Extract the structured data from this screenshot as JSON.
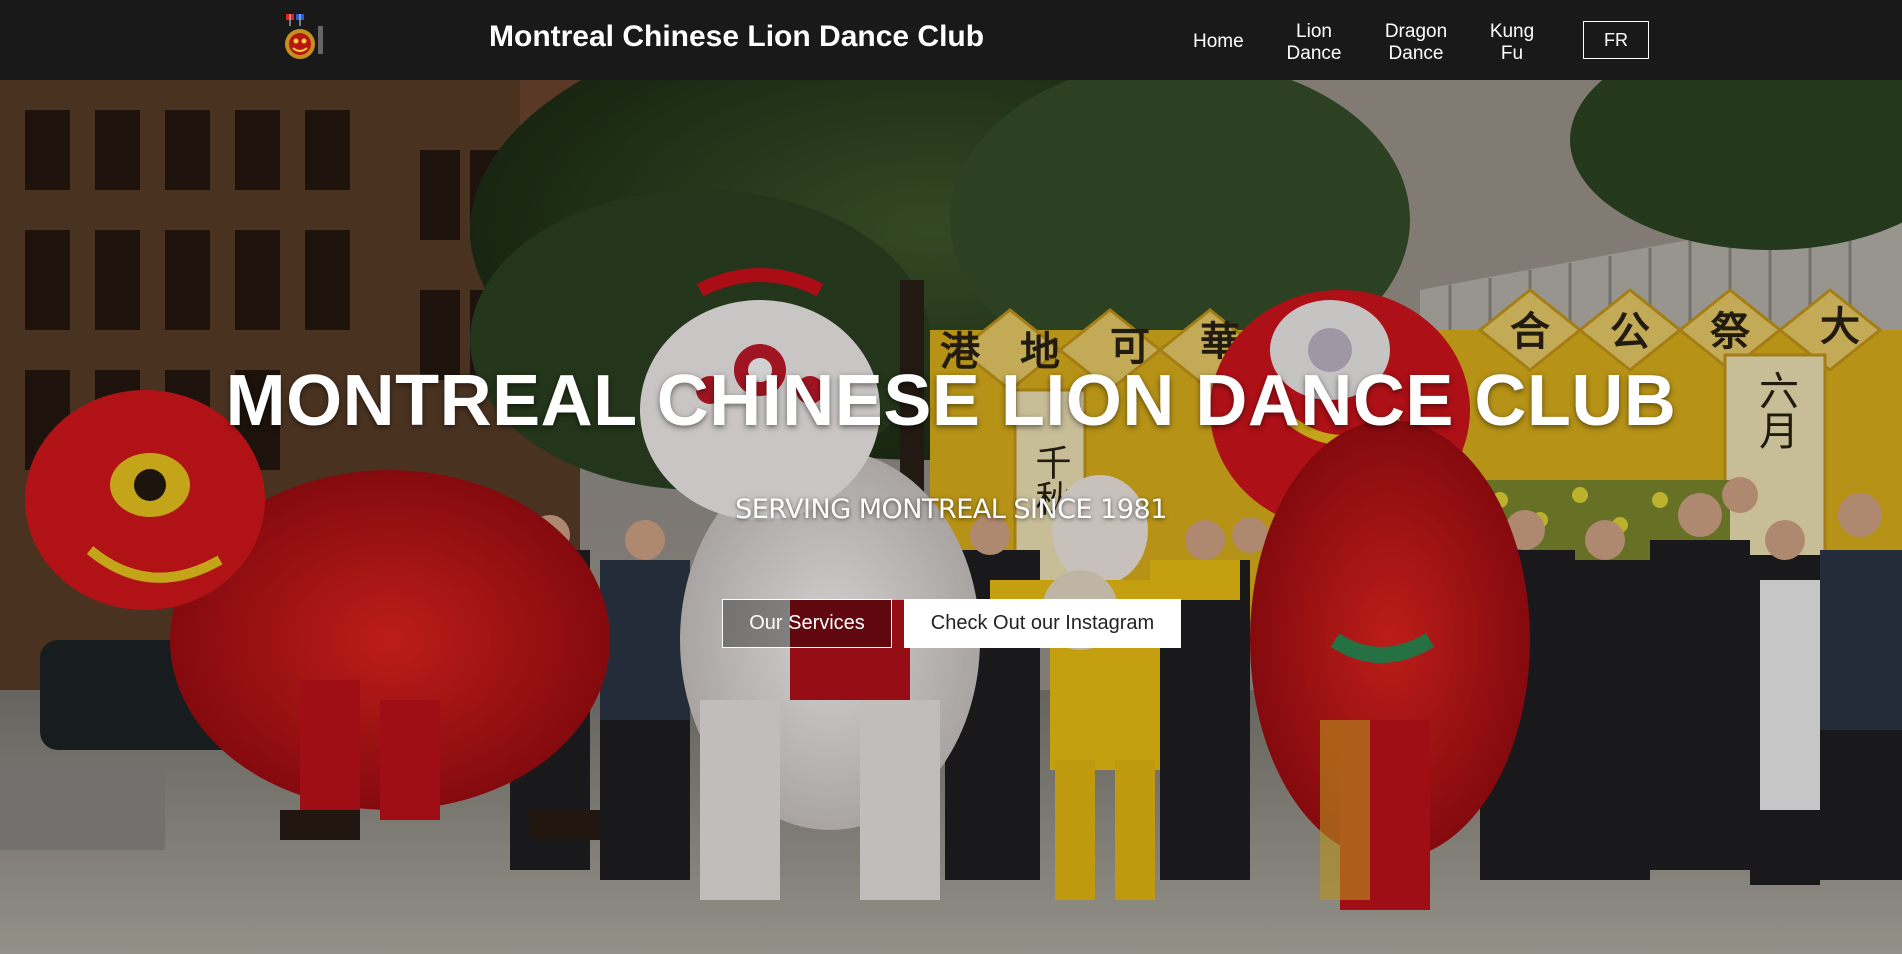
{
  "header": {
    "logo_icon": "club-emblem-icon",
    "title": "Montreal Chinese Lion Dance Club",
    "nav": {
      "home": "Home",
      "lion_line1": "Lion",
      "lion_line2": "Dance",
      "dragon_line1": "Dragon",
      "dragon_line2": "Dance",
      "kungfu_line1": "Kung",
      "kungfu_line2": "Fu"
    },
    "language_toggle": "FR"
  },
  "hero": {
    "title": "MONTREAL CHINESE LION DANCE CLUB",
    "subtitle": "SERVING MONTREAL SINCE 1981",
    "buttons": {
      "services": "Our Services",
      "instagram": "Check Out our Instagram"
    },
    "banner_characters": [
      "港",
      "地",
      "可",
      "華",
      "合",
      "公",
      "祭",
      "大"
    ],
    "banner_vertical_1": "千秋",
    "banner_vertical_2": "六月",
    "colors": {
      "header_bg": "#191919",
      "lion_red": "#d0101a",
      "lion_white": "#f2eeee",
      "banner_yellow": "#e0b21f"
    }
  }
}
